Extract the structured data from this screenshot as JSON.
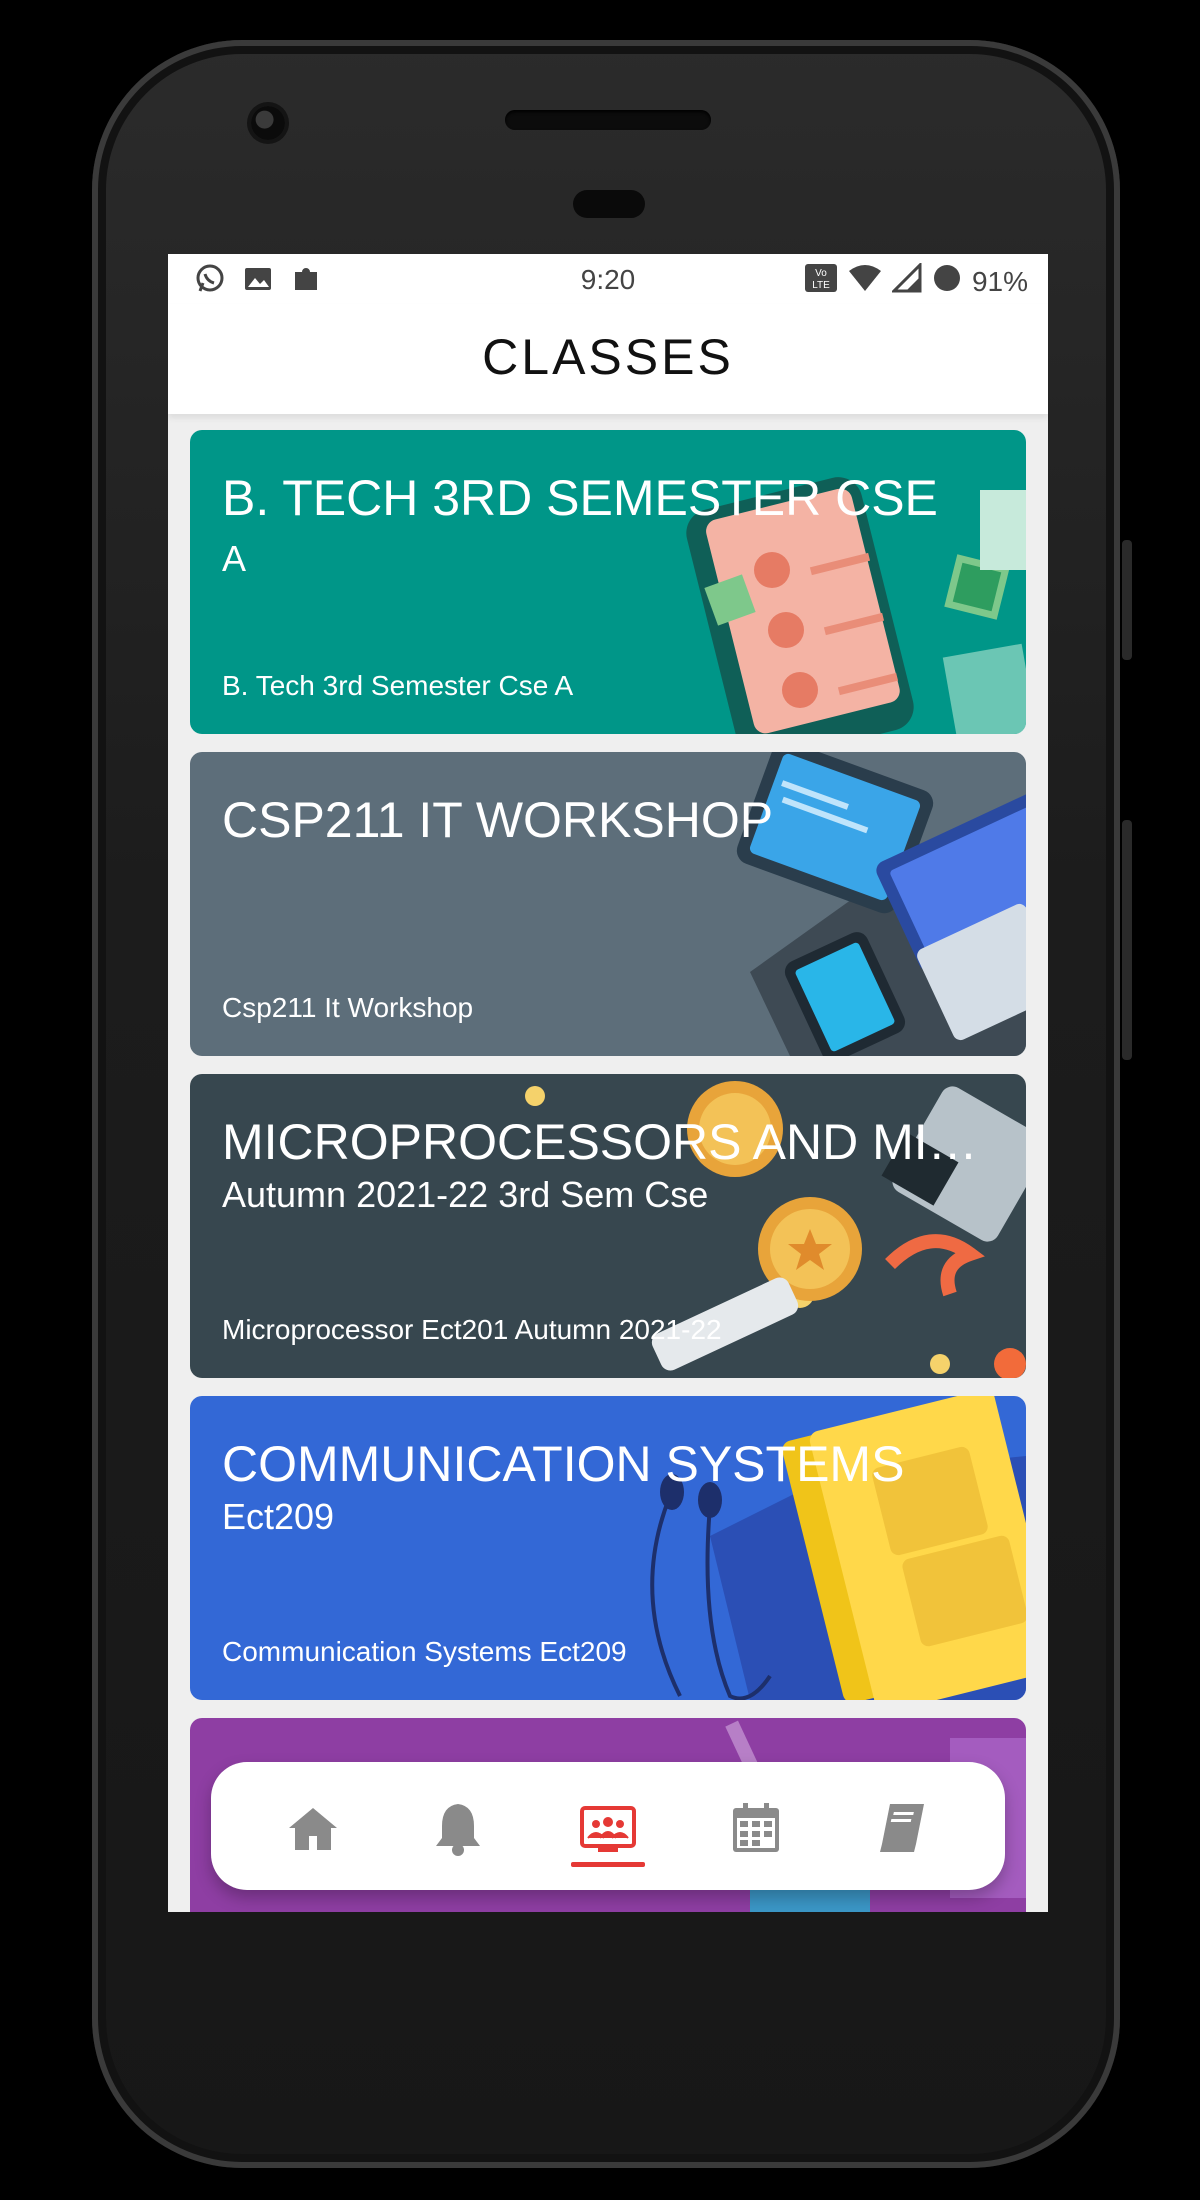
{
  "status_bar": {
    "time": "9:20",
    "battery_percent": "91%",
    "left_icons": [
      "whatsapp-icon",
      "image-icon",
      "puzzle-icon"
    ],
    "right_icons": [
      "volte-icon",
      "wifi-icon",
      "signal-icon",
      "battery-icon"
    ]
  },
  "header": {
    "title": "CLASSES"
  },
  "classes": [
    {
      "title": "B. TECH 3RD SEMESTER CSE",
      "subtitle": "A",
      "footer": "B. Tech 3rd Semester Cse A",
      "color": "#009688"
    },
    {
      "title": "CSP211 IT WORKSHOP",
      "subtitle": "",
      "footer": "Csp211 It Workshop",
      "color": "#5d6e7a"
    },
    {
      "title": "MICROPROCESSORS AND MIC…",
      "subtitle": "Autumn 2021-22 3rd Sem Cse",
      "footer": "Microprocessor Ect201 Autumn 2021-22",
      "color": "#37474f"
    },
    {
      "title": "COMMUNICATION SYSTEMS",
      "subtitle": "Ect209",
      "footer": "Communication Systems Ect209",
      "color": "#3368d6"
    },
    {
      "title": "",
      "subtitle": "",
      "footer": "",
      "color": "#8e3ea3"
    }
  ],
  "bottom_nav": {
    "items": [
      "home-icon",
      "bell-icon",
      "classes-icon",
      "calendar-icon",
      "book-icon"
    ],
    "active": "classes-icon",
    "active_color": "#e53935"
  }
}
